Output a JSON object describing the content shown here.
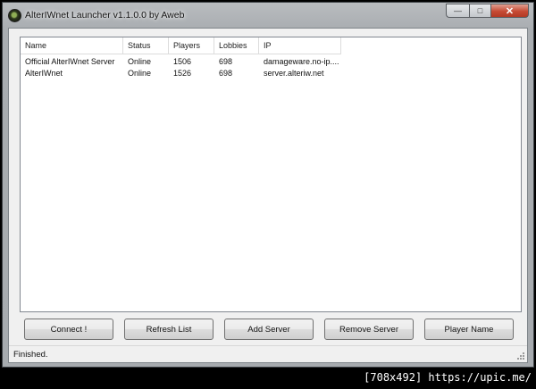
{
  "window": {
    "title": "AlterIWnet Launcher v1.1.0.0 by Aweb",
    "minimize_glyph": "—",
    "maximize_glyph": "□",
    "close_glyph": "✕"
  },
  "list": {
    "columns": [
      "Name",
      "Status",
      "Players",
      "Lobbies",
      "IP"
    ],
    "rows": [
      [
        "Official AlterIWnet Server",
        "Online",
        "1506",
        "698",
        "damageware.no-ip...."
      ],
      [
        "AlterIWnet",
        "Online",
        "1526",
        "698",
        "server.alteriw.net"
      ]
    ]
  },
  "buttons": {
    "connect": "Connect !",
    "refresh": "Refresh List",
    "add": "Add Server",
    "remove": "Remove Server",
    "player_name": "Player Name"
  },
  "status": {
    "text": "Finished."
  },
  "watermark": {
    "text": "[708x492] https://upic.me/"
  }
}
